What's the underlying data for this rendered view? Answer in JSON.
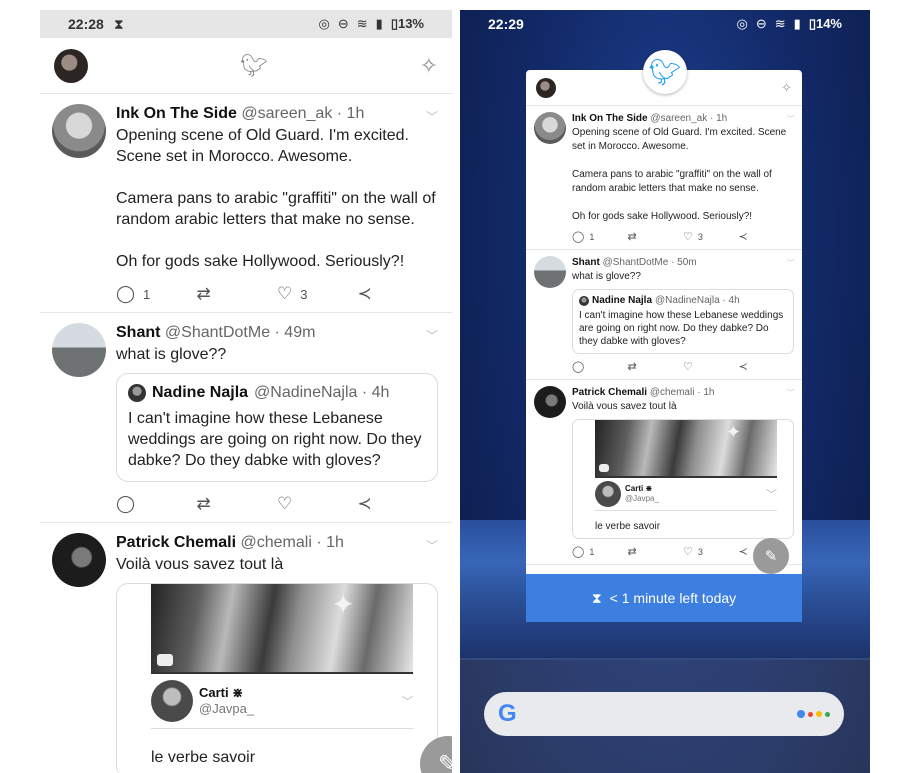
{
  "left": {
    "status": {
      "time": "22:28",
      "battery": "13%"
    },
    "tweets": [
      {
        "name": "Ink On The Side",
        "meta": "@sareen_ak · 1h",
        "text": "Opening scene of Old Guard. I'm excited. Scene set in Morocco. Awesome.\n\nCamera pans to arabic \"graffiti\" on the wall of random arabic letters that make no sense.\n\nOh for gods sake Hollywood. Seriously?!",
        "replies": "1",
        "likes": "3"
      },
      {
        "name": "Shant",
        "meta": "@ShantDotMe · 49m",
        "text": "what is glove??",
        "quote": {
          "name": "Nadine Najla",
          "meta": "@NadineNajla · 4h",
          "text": "I can't imagine how these Lebanese weddings are going on right now. Do they dabke? Do they dabke with gloves?"
        }
      },
      {
        "name": "Patrick Chemali",
        "meta": "@chemali · 1h",
        "text": "Voilà vous savez tout là",
        "media": {
          "inner_name": "Carti ⋇",
          "inner_handle": "@Javpa_",
          "caption": "le verbe savoir"
        }
      }
    ]
  },
  "right": {
    "status": {
      "time": "22:29",
      "battery": "14%"
    },
    "tweets": [
      {
        "name": "Ink On The Side",
        "meta": "@sareen_ak · 1h",
        "text": "Opening scene of Old Guard. I'm excited. Scene set in Morocco. Awesome.\n\nCamera pans to arabic \"graffiti\" on the wall of random arabic letters that make no sense.\n\nOh for gods sake Hollywood. Seriously?!",
        "replies": "1",
        "likes": "3"
      },
      {
        "name": "Shant",
        "meta": "@ShantDotMe · 50m",
        "text": "what is glove??",
        "quote": {
          "name": "Nadine Najla",
          "meta": "@NadineNajla · 4h",
          "text": "I can't imagine how these Lebanese weddings are going on right now. Do they dabke? Do they dabke with gloves?"
        }
      },
      {
        "name": "Patrick Chemali",
        "meta": "@chemali · 1h",
        "text": "Voilà vous savez tout là",
        "likes": "3",
        "replies": "1",
        "media": {
          "inner_name": "Carti ⋇",
          "inner_handle": "@Javpa_",
          "caption": "le verbe savoir"
        }
      }
    ],
    "timer_text": "< 1 minute left today"
  },
  "icons": {
    "hourglass": "hourglass-icon",
    "bird": "twitter-bird-icon",
    "sparkle": "sparkle-icon",
    "reply": "reply-icon",
    "retweet": "retweet-icon",
    "like": "heart-icon",
    "share": "share-icon",
    "compose": "compose-tweet-icon",
    "google": "google-g-icon",
    "assistant": "assistant-icon"
  },
  "colors": {
    "twitter_blue": "#1da1f2",
    "timer_bar": "#3d7fe0",
    "fab_grey": "#9a9a9a"
  }
}
